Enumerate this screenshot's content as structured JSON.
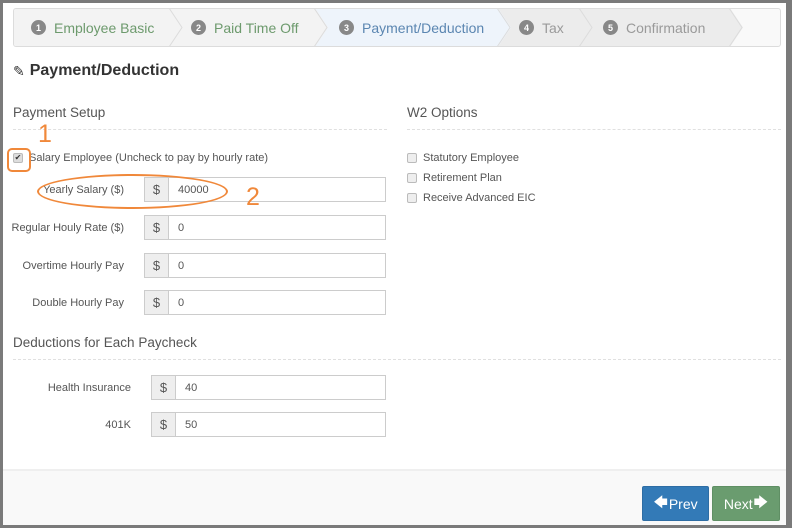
{
  "wizard": {
    "steps": [
      {
        "num": "1",
        "label": "Employee Basic",
        "state": "done"
      },
      {
        "num": "2",
        "label": "Paid Time Off",
        "state": "done"
      },
      {
        "num": "3",
        "label": "Payment/Deduction",
        "state": "active"
      },
      {
        "num": "4",
        "label": "Tax",
        "state": "future"
      },
      {
        "num": "5",
        "label": "Confirmation",
        "state": "future"
      }
    ]
  },
  "page": {
    "title": "Payment/Deduction",
    "title_icon": "pencil-icon"
  },
  "payment_setup": {
    "heading": "Payment Setup",
    "salary_checkbox": {
      "label": "Salary Employee (Uncheck to pay by hourly rate)",
      "checked": true
    },
    "fields": [
      {
        "label": "Yearly Salary ($)",
        "prefix": "$",
        "value": "40000"
      },
      {
        "label": "Regular Houly Rate ($)",
        "prefix": "$",
        "value": "0"
      },
      {
        "label": "Overtime Hourly Pay",
        "prefix": "$",
        "value": "0"
      },
      {
        "label": "Double Hourly Pay",
        "prefix": "$",
        "value": "0"
      }
    ]
  },
  "w2_options": {
    "heading": "W2 Options",
    "options": [
      {
        "label": "Statutory Employee",
        "checked": false
      },
      {
        "label": "Retirement Plan",
        "checked": false
      },
      {
        "label": "Receive Advanced EIC",
        "checked": false
      }
    ]
  },
  "deductions": {
    "heading": "Deductions for Each Paycheck",
    "fields": [
      {
        "label": "Health Insurance",
        "prefix": "$",
        "value": "40"
      },
      {
        "label": "401K",
        "prefix": "$",
        "value": "50"
      }
    ]
  },
  "footer": {
    "prev_label": "Prev",
    "next_label": "Next"
  },
  "annotations": {
    "marker_1": "1",
    "marker_2": "2",
    "color": "#f0883a"
  },
  "colors": {
    "prev_button": "#337ab7",
    "next_button": "#6a9c6f",
    "done_step_text": "#6d9a6d",
    "active_step_text": "#5b86b1"
  }
}
